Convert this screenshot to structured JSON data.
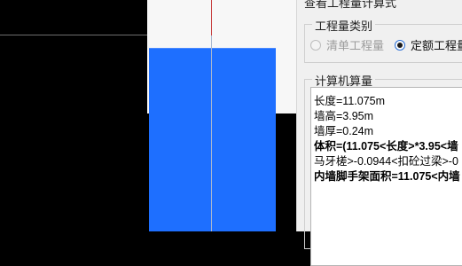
{
  "dialog": {
    "title": "查看工程量计算式",
    "quantity_type": {
      "legend": "工程量类别",
      "options": [
        {
          "label": "清单工程量",
          "checked": false,
          "disabled": true
        },
        {
          "label": "定额工程量",
          "checked": true,
          "disabled": false
        }
      ]
    },
    "computed": {
      "legend": "计算机算量",
      "lines": [
        "长度=11.075m",
        "墙高=3.95m",
        "墙厚=0.24m",
        "体积=(11.075<长度>*3.95<墙",
        "马牙槎>-0.0944<扣砼过梁>-0",
        "内墙脚手架面积=11.075<内墙"
      ]
    }
  },
  "colors": {
    "wall_fill": "#1e6fff",
    "viewport_bg": "#000000",
    "dialog_bg": "#f0f0f0"
  }
}
